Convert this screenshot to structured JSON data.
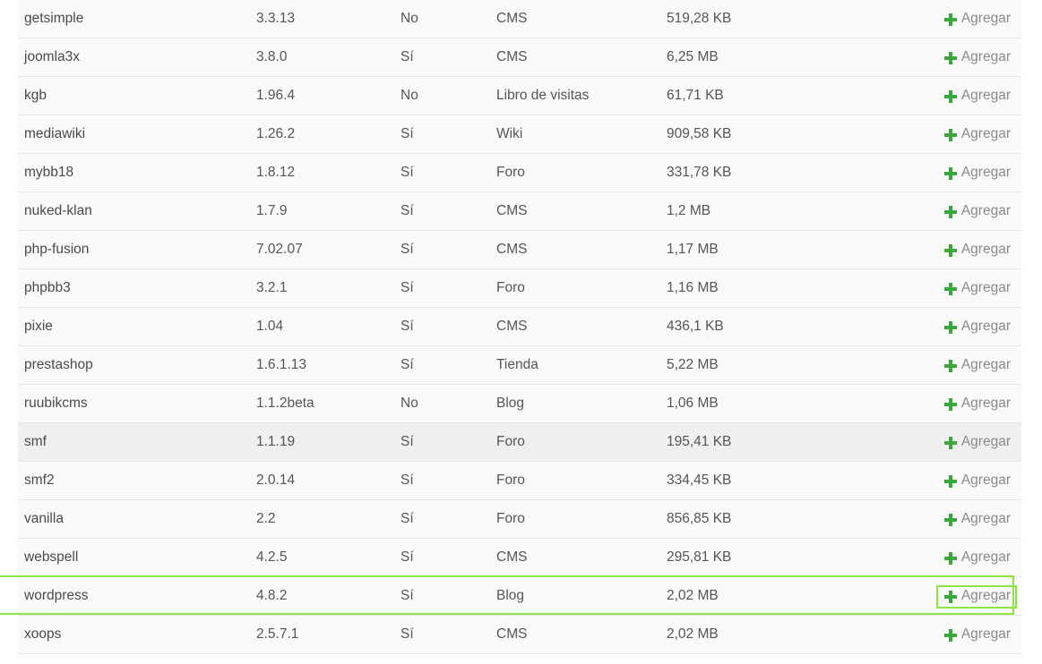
{
  "action_label": "Agregar",
  "colors": {
    "plus_icon": "#3aa83a",
    "highlight": "#8ee53f"
  },
  "rows": [
    {
      "name": "getsimple",
      "version": "3.3.13",
      "flag": "No",
      "category": "CMS",
      "size": "519,28 KB"
    },
    {
      "name": "joomla3x",
      "version": "3.8.0",
      "flag": "Sí",
      "category": "CMS",
      "size": "6,25 MB"
    },
    {
      "name": "kgb",
      "version": "1.96.4",
      "flag": "No",
      "category": "Libro de visitas",
      "size": "61,71 KB"
    },
    {
      "name": "mediawiki",
      "version": "1.26.2",
      "flag": "Sí",
      "category": "Wiki",
      "size": "909,58 KB"
    },
    {
      "name": "mybb18",
      "version": "1.8.12",
      "flag": "Sí",
      "category": "Foro",
      "size": "331,78 KB"
    },
    {
      "name": "nuked-klan",
      "version": "1.7.9",
      "flag": "Sí",
      "category": "CMS",
      "size": "1,2 MB"
    },
    {
      "name": "php-fusion",
      "version": "7.02.07",
      "flag": "Sí",
      "category": "CMS",
      "size": "1,17 MB"
    },
    {
      "name": "phpbb3",
      "version": "3.2.1",
      "flag": "Sí",
      "category": "Foro",
      "size": "1,16 MB"
    },
    {
      "name": "pixie",
      "version": "1.04",
      "flag": "Sí",
      "category": "CMS",
      "size": "436,1 KB"
    },
    {
      "name": "prestashop",
      "version": "1.6.1.13",
      "flag": "Sí",
      "category": "Tienda",
      "size": "5,22 MB"
    },
    {
      "name": "ruubikcms",
      "version": "1.1.2beta",
      "flag": "No",
      "category": "Blog",
      "size": "1,06 MB"
    },
    {
      "name": "smf",
      "version": "1.1.19",
      "flag": "Sí",
      "category": "Foro",
      "size": "195,41 KB"
    },
    {
      "name": "smf2",
      "version": "2.0.14",
      "flag": "Sí",
      "category": "Foro",
      "size": "334,45 KB"
    },
    {
      "name": "vanilla",
      "version": "2.2",
      "flag": "Sí",
      "category": "Foro",
      "size": "856,85 KB"
    },
    {
      "name": "webspell",
      "version": "4.2.5",
      "flag": "Sí",
      "category": "CMS",
      "size": "295,81 KB"
    },
    {
      "name": "wordpress",
      "version": "4.8.2",
      "flag": "Sí",
      "category": "Blog",
      "size": "2,02 MB"
    },
    {
      "name": "xoops",
      "version": "2.5.7.1",
      "flag": "Sí",
      "category": "CMS",
      "size": "2,02 MB"
    }
  ]
}
